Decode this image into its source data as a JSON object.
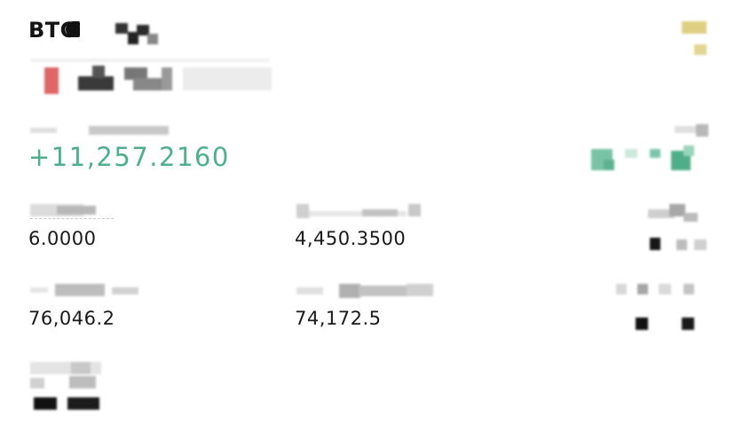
{
  "position": {
    "symbol": "BTC",
    "unrealized_pnl": "+11,257.2160",
    "size": "6.0000",
    "margin": "4,450.3500",
    "entry_price": "76,046.2",
    "mark_price": "74,172.5"
  },
  "colors": {
    "profit": "#4caf8f",
    "text": "#141414",
    "short_badge": "#d9534f",
    "accent_icon": "#d4c36a"
  }
}
